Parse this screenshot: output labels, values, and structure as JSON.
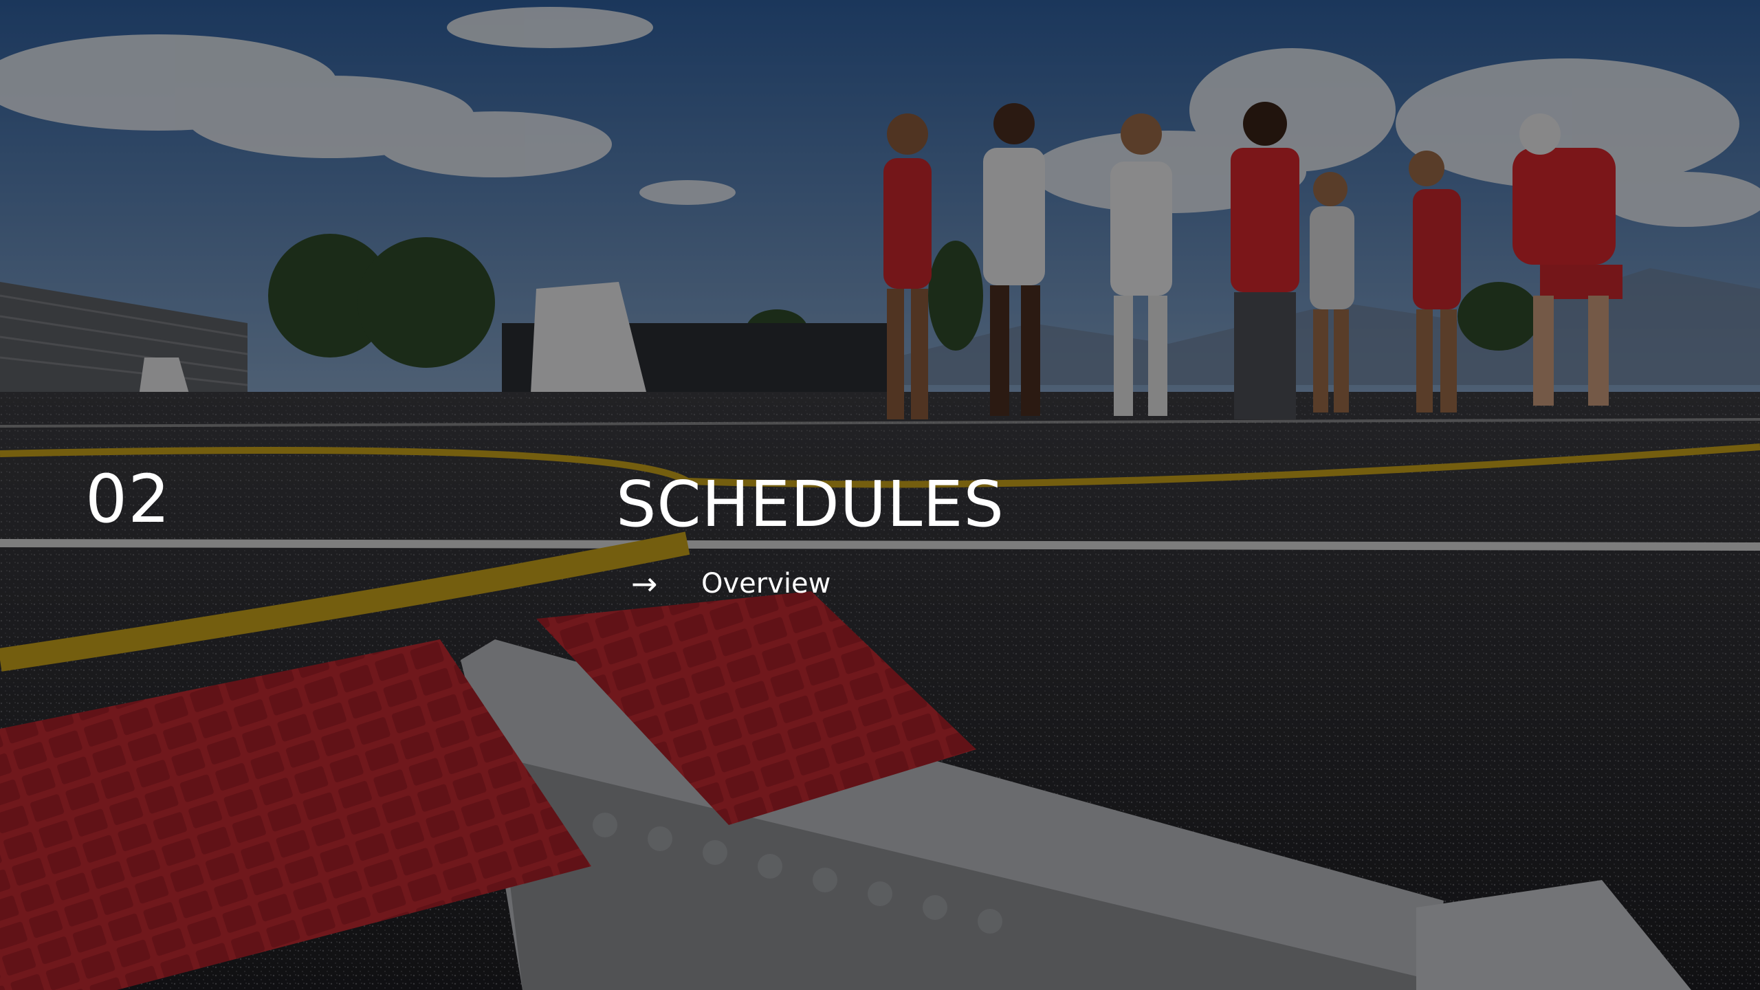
{
  "slide": {
    "section_number": "02",
    "section_title": "SCHEDULES",
    "items": [
      {
        "arrow": "→",
        "label": "Overview"
      }
    ]
  },
  "background": {
    "description_icon": "track-photo-background",
    "colors": {
      "sky": "#3f6fa8",
      "cloud": "#d9dde3",
      "track": "#2a2a2e",
      "lane_yellow": "#c9a21a",
      "lane_white": "#d8d8d8",
      "block_red": "#b3242b",
      "overlay": "#000000"
    }
  }
}
